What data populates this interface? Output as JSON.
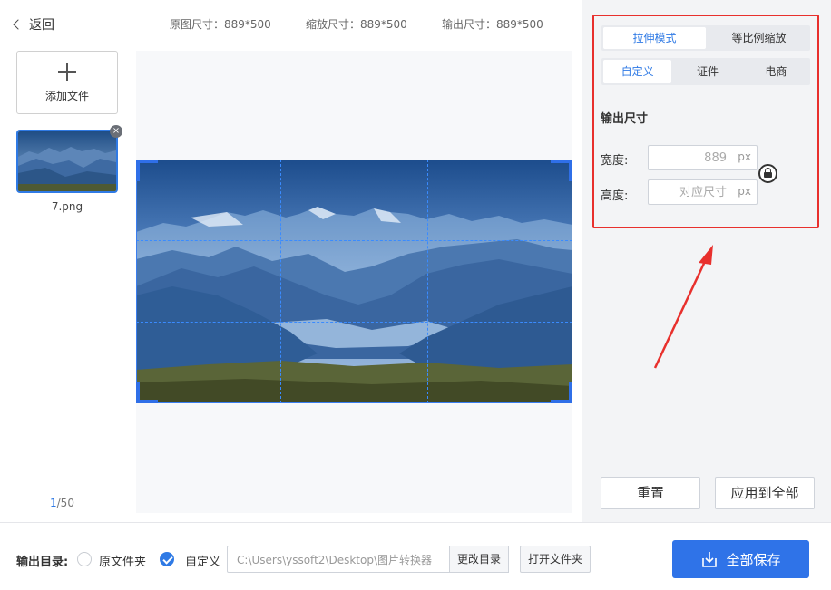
{
  "header": {
    "back_label": "返回",
    "original_size": "原图尺寸：889*500",
    "scaled_size": "缩放尺寸：889*500",
    "output_size": "输出尺寸：889*500"
  },
  "sidebar": {
    "add_file_label": "添加文件",
    "files": [
      {
        "name": "7.png",
        "close_glyph": "×"
      }
    ],
    "pager": {
      "current": "1",
      "total": "/50"
    }
  },
  "settings": {
    "mode_tabs": [
      {
        "label": "拉伸模式",
        "active": true
      },
      {
        "label": "等比例缩放",
        "active": false
      }
    ],
    "preset_tabs": [
      {
        "label": "自定义",
        "active": true
      },
      {
        "label": "证件",
        "active": false
      },
      {
        "label": "电商",
        "active": false
      }
    ],
    "output_title": "输出尺寸",
    "width_label": "宽度:",
    "width_placeholder": "889",
    "height_label": "高度:",
    "height_placeholder": "对应尺寸",
    "unit": "px",
    "reset_label": "重置",
    "apply_all_label": "应用到全部"
  },
  "footer": {
    "output_dir_label": "输出目录:",
    "option_original": "原文件夹",
    "option_custom": "自定义",
    "selected_option": "custom",
    "path_value": "C:\\Users\\yssoft2\\Desktop\\图片转换器",
    "change_dir_label": "更改目录",
    "open_folder_label": "打开文件夹",
    "save_all_label": "全部保存"
  },
  "colors": {
    "accent": "#2f7ae5",
    "highlight_box": "#e8302d",
    "panel_bg": "#f3f4f6"
  }
}
